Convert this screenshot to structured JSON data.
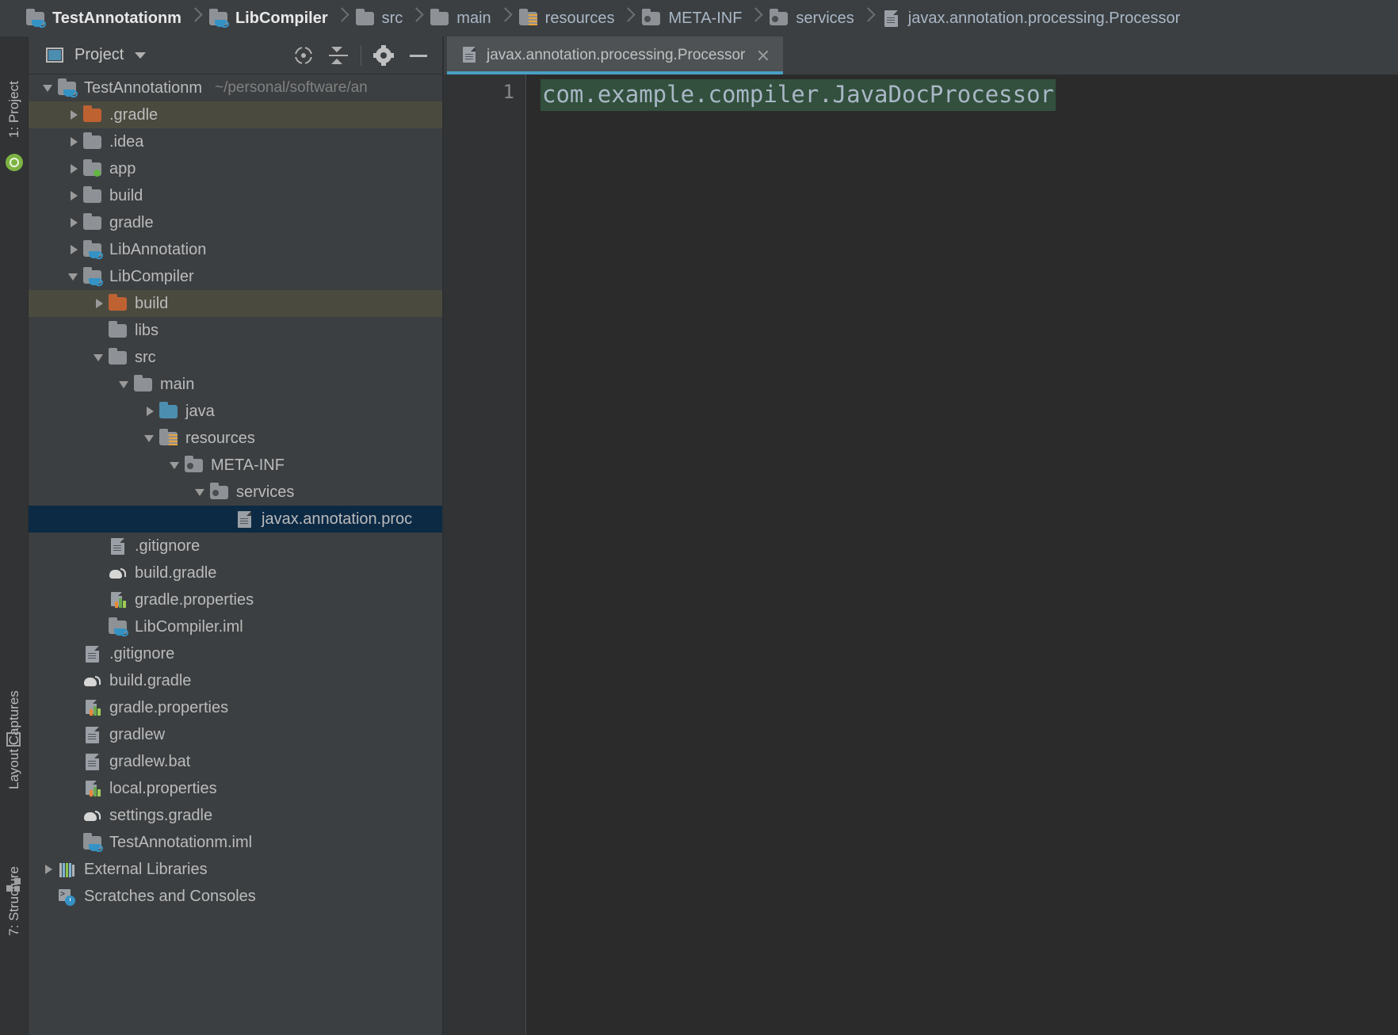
{
  "breadcrumb": {
    "items": [
      {
        "label": "TestAnnotationm",
        "icon": "module-folder-icon",
        "bold": true
      },
      {
        "label": "LibCompiler",
        "icon": "module-folder-icon",
        "bold": true
      },
      {
        "label": "src",
        "icon": "folder-icon",
        "bold": false
      },
      {
        "label": "main",
        "icon": "folder-icon",
        "bold": false
      },
      {
        "label": "resources",
        "icon": "resources-folder-icon",
        "bold": false
      },
      {
        "label": "META-INF",
        "icon": "meta-inf-folder-icon",
        "bold": false
      },
      {
        "label": "services",
        "icon": "meta-inf-folder-icon",
        "bold": false
      },
      {
        "label": "javax.annotation.processing.Processor",
        "icon": "file-icon",
        "bold": false
      }
    ]
  },
  "tool_strip": {
    "project_label": "1: Project",
    "layout_captures_label": "Layout Captures",
    "structure_label": "7: Structure",
    "android_icon": "android-studio-icon",
    "capture_icon": "layout-capture-icon",
    "structure_icon": "structure-squares-icon"
  },
  "project_panel": {
    "title": "Project",
    "title_icon": "project-view-icon",
    "dropdown_icon": "chevron-down-icon",
    "tools": [
      {
        "name": "scroll-from-source-button",
        "icon": "target-icon"
      },
      {
        "name": "collapse-all-button",
        "icon": "collapse-all-icon"
      },
      {
        "name": "settings-button",
        "icon": "gear-icon"
      },
      {
        "name": "hide-panel-button",
        "icon": "minimize-icon"
      }
    ]
  },
  "tree": {
    "rows": [
      {
        "label": "TestAnnotationm",
        "sublabel": "~/personal/software/an",
        "indent": 0,
        "arrow": "open",
        "icon": "module-folder-icon",
        "state": "normal"
      },
      {
        "label": ".gradle",
        "sublabel": "",
        "indent": 1,
        "arrow": "closed",
        "icon": "orange-folder-icon",
        "state": "hover"
      },
      {
        "label": ".idea",
        "sublabel": "",
        "indent": 1,
        "arrow": "closed",
        "icon": "folder-icon",
        "state": "normal"
      },
      {
        "label": "app",
        "sublabel": "",
        "indent": 1,
        "arrow": "closed",
        "icon": "module-folder-green-icon",
        "state": "normal"
      },
      {
        "label": "build",
        "sublabel": "",
        "indent": 1,
        "arrow": "closed",
        "icon": "folder-icon",
        "state": "normal"
      },
      {
        "label": "gradle",
        "sublabel": "",
        "indent": 1,
        "arrow": "closed",
        "icon": "folder-icon",
        "state": "normal"
      },
      {
        "label": "LibAnnotation",
        "sublabel": "",
        "indent": 1,
        "arrow": "closed",
        "icon": "module-folder-icon",
        "state": "normal"
      },
      {
        "label": "LibCompiler",
        "sublabel": "",
        "indent": 1,
        "arrow": "open",
        "icon": "module-folder-icon",
        "state": "normal"
      },
      {
        "label": "build",
        "sublabel": "",
        "indent": 2,
        "arrow": "closed",
        "icon": "orange-folder-icon",
        "state": "hover"
      },
      {
        "label": "libs",
        "sublabel": "",
        "indent": 2,
        "arrow": "none",
        "icon": "folder-icon",
        "state": "normal"
      },
      {
        "label": "src",
        "sublabel": "",
        "indent": 2,
        "arrow": "open",
        "icon": "folder-icon",
        "state": "normal"
      },
      {
        "label": "main",
        "sublabel": "",
        "indent": 3,
        "arrow": "open",
        "icon": "folder-icon",
        "state": "normal"
      },
      {
        "label": "java",
        "sublabel": "",
        "indent": 4,
        "arrow": "closed",
        "icon": "source-root-folder-icon",
        "state": "normal"
      },
      {
        "label": "resources",
        "sublabel": "",
        "indent": 4,
        "arrow": "open",
        "icon": "resources-folder-icon",
        "state": "normal"
      },
      {
        "label": "META-INF",
        "sublabel": "",
        "indent": 5,
        "arrow": "open",
        "icon": "meta-inf-folder-icon",
        "state": "normal"
      },
      {
        "label": "services",
        "sublabel": "",
        "indent": 6,
        "arrow": "open",
        "icon": "meta-inf-folder-icon",
        "state": "normal"
      },
      {
        "label": "javax.annotation.proc",
        "sublabel": "",
        "indent": 7,
        "arrow": "none",
        "icon": "file-icon",
        "state": "selected"
      },
      {
        "label": ".gitignore",
        "sublabel": "",
        "indent": 2,
        "arrow": "none",
        "icon": "file-icon",
        "state": "normal"
      },
      {
        "label": "build.gradle",
        "sublabel": "",
        "indent": 2,
        "arrow": "none",
        "icon": "gradle-icon",
        "state": "normal"
      },
      {
        "label": "gradle.properties",
        "sublabel": "",
        "indent": 2,
        "arrow": "none",
        "icon": "properties-icon",
        "state": "normal"
      },
      {
        "label": "LibCompiler.iml",
        "sublabel": "",
        "indent": 2,
        "arrow": "none",
        "icon": "module-folder-icon",
        "state": "normal"
      },
      {
        "label": ".gitignore",
        "sublabel": "",
        "indent": 1,
        "arrow": "none",
        "icon": "file-icon",
        "state": "normal"
      },
      {
        "label": "build.gradle",
        "sublabel": "",
        "indent": 1,
        "arrow": "none",
        "icon": "gradle-icon",
        "state": "normal"
      },
      {
        "label": "gradle.properties",
        "sublabel": "",
        "indent": 1,
        "arrow": "none",
        "icon": "properties-icon",
        "state": "normal"
      },
      {
        "label": "gradlew",
        "sublabel": "",
        "indent": 1,
        "arrow": "none",
        "icon": "file-icon",
        "state": "normal"
      },
      {
        "label": "gradlew.bat",
        "sublabel": "",
        "indent": 1,
        "arrow": "none",
        "icon": "file-icon",
        "state": "normal"
      },
      {
        "label": "local.properties",
        "sublabel": "",
        "indent": 1,
        "arrow": "none",
        "icon": "properties-icon",
        "state": "normal"
      },
      {
        "label": "settings.gradle",
        "sublabel": "",
        "indent": 1,
        "arrow": "none",
        "icon": "gradle-icon",
        "state": "normal"
      },
      {
        "label": "TestAnnotationm.iml",
        "sublabel": "",
        "indent": 1,
        "arrow": "none",
        "icon": "module-folder-icon",
        "state": "normal"
      },
      {
        "label": "External Libraries",
        "sublabel": "",
        "indent": 0,
        "arrow": "closed",
        "icon": "external-libraries-icon",
        "state": "normal"
      },
      {
        "label": "Scratches and Consoles",
        "sublabel": "",
        "indent": 0,
        "arrow": "none",
        "icon": "scratches-icon",
        "state": "normal"
      }
    ]
  },
  "editor": {
    "tab_label": "javax.annotation.processing.Processor",
    "tab_icon": "file-icon",
    "close_icon": "close-icon",
    "line_number": "1",
    "code_text": "com.example.compiler.JavaDocProcessor",
    "accent_color": "#4a9ec4",
    "selection_color": "#32503d"
  }
}
